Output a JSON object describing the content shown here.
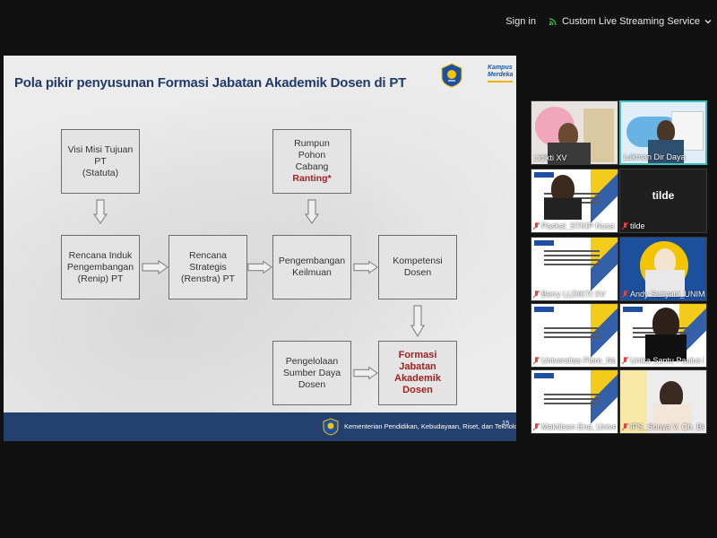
{
  "topbar": {
    "signin_label": "Sign in",
    "stream_label": "Custom Live Streaming Service"
  },
  "slide": {
    "title": "Pola pikir penyusunan Formasi Jabatan Akademik Dosen di PT",
    "kampus_merdeka_logo": "Kampus Merdeka",
    "boxes": {
      "visi": "Visi Misi Tujuan\nPT\n(Statuta)",
      "rumpun": "Rumpun\nPohon\nCabang",
      "ranting": "Ranting*",
      "renip": "Rencana Induk\nPengembangan\n(Renip) PT",
      "renstra": "Rencana\nStrategis\n(Renstra) PT",
      "pengembangan": "Pengembangan\nKeilmuan",
      "kompetensi": "Kompetensi\nDosen",
      "pengelolaan": "Pengelolaan\nSumber Daya\nDosen",
      "formasi": "Formasi\nJabatan\nAkademik\nDosen"
    },
    "footer": "Kementerian Pendidikan, Kebudayaan, Riset, dan Teknologi",
    "page_number": "15",
    "colors": {
      "footer": "#23406f",
      "title": "#1f3a6b",
      "highlight": "#a32020"
    }
  },
  "participants": [
    {
      "name": "Lldikti XV",
      "muted": false
    },
    {
      "name": "Lukman Dir Daya",
      "muted": false,
      "active": true
    },
    {
      "name": "Paskal_STKIP Nusa Tim",
      "muted": true
    },
    {
      "name": "tilde",
      "muted": true,
      "camera_off": true
    },
    {
      "name": "Berry LLDIKTI XV",
      "muted": true
    },
    {
      "name": "Andy Suriyani_UNIMOF",
      "muted": true
    },
    {
      "name": "Universitas Flore_Nat...",
      "muted": true
    },
    {
      "name": "Unika Santu Paulus Ru...",
      "muted": true
    },
    {
      "name": "Maktilsen Ena_Universi...",
      "muted": true
    },
    {
      "name": "IPS_Sonya V. Ch. Benu",
      "muted": true
    }
  ]
}
